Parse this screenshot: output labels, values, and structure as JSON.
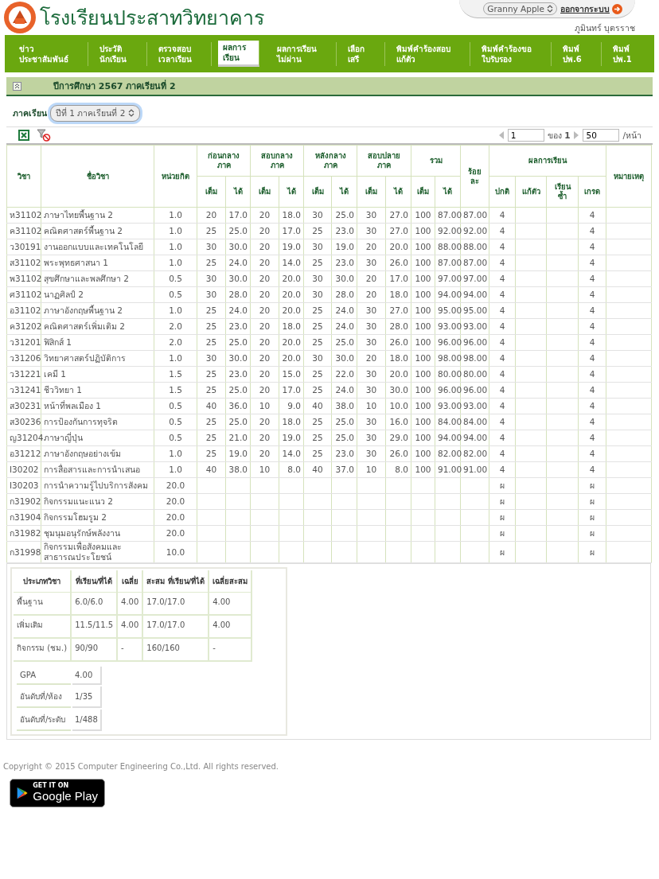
{
  "header": {
    "school_name": "โรงเรียนประสาทวิทยาคาร",
    "theme_select": "Granny Apple",
    "logout": "ออกจากระบบ",
    "user_name": "ภูมินทร์ บุตรราช"
  },
  "nav": [
    {
      "label": "ข่าว\nประชาสัมพันธ์",
      "selected": false
    },
    {
      "label": "ประวัติ\nนักเรียน",
      "selected": false
    },
    {
      "label": "ตรวจสอบ\nเวลาเรียน",
      "selected": false
    },
    {
      "label": "ผลการ\nเรียน",
      "selected": true
    },
    {
      "label": "ผลการเรียน\nไม่ผ่าน",
      "selected": false
    },
    {
      "label": "เลือก\nเสรี",
      "selected": false
    },
    {
      "label": "พิมพ์คำร้องสอบ\nแก้ตัว",
      "selected": false
    },
    {
      "label": "พิมพ์คำร้องขอ\nใบรับรอง",
      "selected": false
    },
    {
      "label": "พิมพ์\nปพ.6",
      "selected": false
    },
    {
      "label": "พิมพ์\nปพ.1",
      "selected": false
    }
  ],
  "section": {
    "title": "ปีการศึกษา 2567 ภาคเรียนที่ 2",
    "expanded": true
  },
  "semester": {
    "label": "ภาคเรียน",
    "value": "ปีที่ 1 ภาคเรียนที่ 2"
  },
  "pager": {
    "page": "1",
    "of_label": "ของ",
    "total_pages": "1",
    "page_size": "50",
    "per_page_label": "/หน้า"
  },
  "table": {
    "columns": [
      {
        "label": "วิชา"
      },
      {
        "label": "ชื่อวิชา"
      },
      {
        "label": "หน่วยกิต"
      },
      {
        "label": "ก่อนกลาง\nภาค",
        "sub": [
          "เต็ม",
          "ได้"
        ]
      },
      {
        "label": "สอบกลาง\nภาค",
        "sub": [
          "เต็ม",
          "ได้"
        ]
      },
      {
        "label": "หลังกลาง\nภาค",
        "sub": [
          "เต็ม",
          "ได้"
        ]
      },
      {
        "label": "สอบปลาย\nภาค",
        "sub": [
          "เต็ม",
          "ได้"
        ]
      },
      {
        "label": "รวม",
        "sub": [
          "เต็ม",
          "ได้"
        ]
      },
      {
        "label": "ร้อย\nละ"
      },
      {
        "label": "ผลการเรียน",
        "sub": [
          "ปกติ",
          "แก้ตัว",
          "เรียน\nซ้ำ",
          "เกรด"
        ]
      },
      {
        "label": "หมายเหตุ"
      }
    ],
    "rows": [
      {
        "code": "ห31102",
        "name": "ภาษาไทยพื้นฐาน 2",
        "credits": "1.0",
        "scores": [
          "20",
          "17.0",
          "20",
          "18.0",
          "30",
          "25.0",
          "30",
          "27.0",
          "100",
          "87.00"
        ],
        "percent": "87.00",
        "normal": "4",
        "grade": "4"
      },
      {
        "code": "ค31102",
        "name": "คณิตศาสตร์พื้นฐาน 2",
        "credits": "1.0",
        "scores": [
          "25",
          "25.0",
          "20",
          "17.0",
          "25",
          "23.0",
          "30",
          "27.0",
          "100",
          "92.00"
        ],
        "percent": "92.00",
        "normal": "4",
        "grade": "4"
      },
      {
        "code": "ว30191",
        "name": "งานออกแบบและเทคโนโลยี",
        "credits": "1.0",
        "scores": [
          "30",
          "30.0",
          "20",
          "19.0",
          "30",
          "19.0",
          "20",
          "20.0",
          "100",
          "88.00"
        ],
        "percent": "88.00",
        "normal": "4",
        "grade": "4"
      },
      {
        "code": "ส31102",
        "name": "พระพุทธศาสนา 1",
        "credits": "1.0",
        "scores": [
          "25",
          "24.0",
          "20",
          "14.0",
          "25",
          "23.0",
          "30",
          "26.0",
          "100",
          "87.00"
        ],
        "percent": "87.00",
        "normal": "4",
        "grade": "4"
      },
      {
        "code": "พ31102",
        "name": "สุขศึกษาและพลศึกษา 2",
        "credits": "0.5",
        "scores": [
          "30",
          "30.0",
          "20",
          "20.0",
          "30",
          "30.0",
          "20",
          "17.0",
          "100",
          "97.00"
        ],
        "percent": "97.00",
        "normal": "4",
        "grade": "4"
      },
      {
        "code": "ศ31102",
        "name": "นาฏศิลป์ 2",
        "credits": "0.5",
        "scores": [
          "30",
          "28.0",
          "20",
          "20.0",
          "30",
          "28.0",
          "20",
          "18.0",
          "100",
          "94.00"
        ],
        "percent": "94.00",
        "normal": "4",
        "grade": "4"
      },
      {
        "code": "อ31102",
        "name": "ภาษาอังกฤษพื้นฐาน 2",
        "credits": "1.0",
        "scores": [
          "25",
          "24.0",
          "20",
          "20.0",
          "25",
          "24.0",
          "30",
          "27.0",
          "100",
          "95.00"
        ],
        "percent": "95.00",
        "normal": "4",
        "grade": "4"
      },
      {
        "code": "ค31202",
        "name": "คณิตศาสตร์เพิ่มเติม 2",
        "credits": "2.0",
        "scores": [
          "25",
          "23.0",
          "20",
          "18.0",
          "25",
          "24.0",
          "30",
          "28.0",
          "100",
          "93.00"
        ],
        "percent": "93.00",
        "normal": "4",
        "grade": "4"
      },
      {
        "code": "ว31201",
        "name": "ฟิสิกส์ 1",
        "credits": "2.0",
        "scores": [
          "25",
          "25.0",
          "20",
          "20.0",
          "25",
          "25.0",
          "30",
          "26.0",
          "100",
          "96.00"
        ],
        "percent": "96.00",
        "normal": "4",
        "grade": "4"
      },
      {
        "code": "ว31206",
        "name": "วิทยาศาสตร์ปฏิบัติการ",
        "credits": "1.0",
        "scores": [
          "30",
          "30.0",
          "20",
          "20.0",
          "30",
          "30.0",
          "20",
          "18.0",
          "100",
          "98.00"
        ],
        "percent": "98.00",
        "normal": "4",
        "grade": "4"
      },
      {
        "code": "ว31221",
        "name": "เคมี 1",
        "credits": "1.5",
        "scores": [
          "25",
          "23.0",
          "20",
          "15.0",
          "25",
          "22.0",
          "30",
          "20.0",
          "100",
          "80.00"
        ],
        "percent": "80.00",
        "normal": "4",
        "grade": "4"
      },
      {
        "code": "ว31241",
        "name": "ชีววิทยา 1",
        "credits": "1.5",
        "scores": [
          "25",
          "25.0",
          "20",
          "17.0",
          "25",
          "24.0",
          "30",
          "30.0",
          "100",
          "96.00"
        ],
        "percent": "96.00",
        "normal": "4",
        "grade": "4"
      },
      {
        "code": "ส30231",
        "name": "หน้าที่พลเมือง 1",
        "credits": "0.5",
        "scores": [
          "40",
          "36.0",
          "10",
          "9.0",
          "40",
          "38.0",
          "10",
          "10.0",
          "100",
          "93.00"
        ],
        "percent": "93.00",
        "normal": "4",
        "grade": "4"
      },
      {
        "code": "ส30236",
        "name": "การป้องกันการทุจริต",
        "credits": "0.5",
        "scores": [
          "25",
          "25.0",
          "20",
          "18.0",
          "25",
          "25.0",
          "30",
          "16.0",
          "100",
          "84.00"
        ],
        "percent": "84.00",
        "normal": "4",
        "grade": "4"
      },
      {
        "code": "ญ31204",
        "name": "ภาษาญี่ปุ่น",
        "credits": "0.5",
        "scores": [
          "25",
          "21.0",
          "20",
          "19.0",
          "25",
          "25.0",
          "30",
          "29.0",
          "100",
          "94.00"
        ],
        "percent": "94.00",
        "normal": "4",
        "grade": "4"
      },
      {
        "code": "อ31212",
        "name": "ภาษาอังกฤษอย่างเข้ม",
        "credits": "1.0",
        "scores": [
          "25",
          "19.0",
          "20",
          "14.0",
          "25",
          "23.0",
          "30",
          "26.0",
          "100",
          "82.00"
        ],
        "percent": "82.00",
        "normal": "4",
        "grade": "4"
      },
      {
        "code": "I30202",
        "name": "การสื่อสารและการนำเสนอ",
        "credits": "1.0",
        "scores": [
          "40",
          "38.0",
          "10",
          "8.0",
          "40",
          "37.0",
          "10",
          "8.0",
          "100",
          "91.00"
        ],
        "percent": "91.00",
        "normal": "4",
        "grade": "4"
      },
      {
        "code": "I30203",
        "name": "การนำความรู้ไปบริการสังคม",
        "credits": "20.0",
        "normal": "ผ",
        "grade": "ผ"
      },
      {
        "code": "ก31902",
        "name": "กิจกรรมแนะแนว 2",
        "credits": "20.0",
        "normal": "ผ",
        "grade": "ผ"
      },
      {
        "code": "ก31904",
        "name": "กิจกรรมโฮมรูม 2",
        "credits": "20.0",
        "normal": "ผ",
        "grade": "ผ"
      },
      {
        "code": "ก31982",
        "name": "ชุมนุมอนุรักษ์พลังงาน",
        "credits": "20.0",
        "normal": "ผ",
        "grade": "ผ"
      },
      {
        "code": "ก31998",
        "name": "กิจกรรมเพื่อสังคมและสาธารณประโยชน์",
        "credits": "10.0",
        "normal": "ผ",
        "grade": "ผ"
      }
    ]
  },
  "summary": {
    "columns": [
      "ประเภทวิชา",
      "ที่เรียน/ที่ได้",
      "เฉลี่ย",
      "สะสม ที่เรียน/ที่ได้",
      "เฉลี่ยสะสม"
    ],
    "rows": [
      [
        "พื้นฐาน",
        "6.0/6.0",
        "4.00",
        "17.0/17.0",
        "4.00"
      ],
      [
        "เพิ่มเติม",
        "11.5/11.5",
        "4.00",
        "17.0/17.0",
        "4.00"
      ],
      [
        "กิจกรรม (ชม.)",
        "90/90",
        "-",
        "160/160",
        "-"
      ]
    ],
    "stats": [
      {
        "label": "GPA",
        "value": "4.00"
      },
      {
        "label": "อันดับที่/ห้อง",
        "value": "1/35"
      },
      {
        "label": "อันดับที่/ระดับ",
        "value": "1/488"
      }
    ]
  },
  "footer": {
    "copyright": "Copyright © 2015 Computer Engineering Co.,Ltd. All rights reserved.",
    "badge_small": "GET IT ON",
    "badge_big": "Google Play"
  }
}
